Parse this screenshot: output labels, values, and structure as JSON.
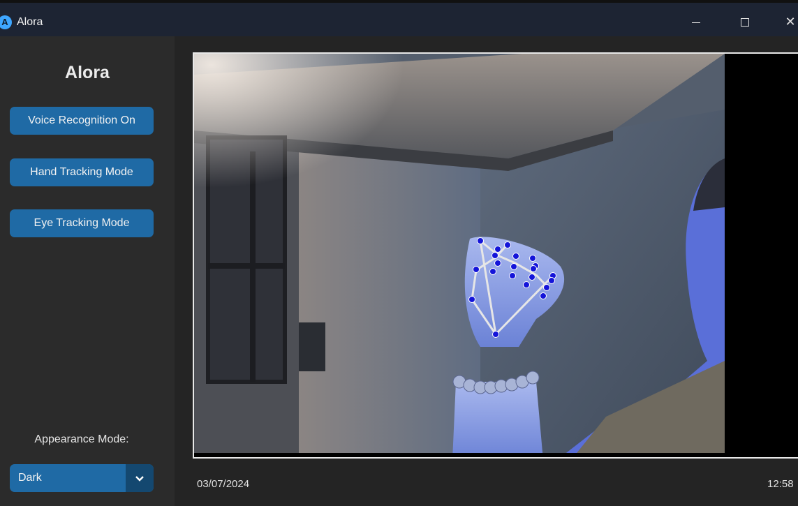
{
  "window": {
    "title": "Alora",
    "icon_letter": "A",
    "minimize_symbol": "—",
    "close_symbol": "✕"
  },
  "sidebar": {
    "logo": "Alora",
    "buttons": {
      "voice": "Voice Recognition On",
      "hand": "Hand Tracking Mode",
      "eye": "Eye Tracking Mode"
    },
    "appearance_label": "Appearance Mode:",
    "appearance_value": "Dark"
  },
  "status": {
    "date": "03/07/2024",
    "time": "12:58"
  },
  "colors": {
    "accent": "#1f6aa5",
    "accent_dark": "#144870",
    "sidebar_bg": "#2b2b2b",
    "main_bg": "#242424",
    "titlebar_bg": "#1d2433",
    "landmark": "#1414d9"
  }
}
